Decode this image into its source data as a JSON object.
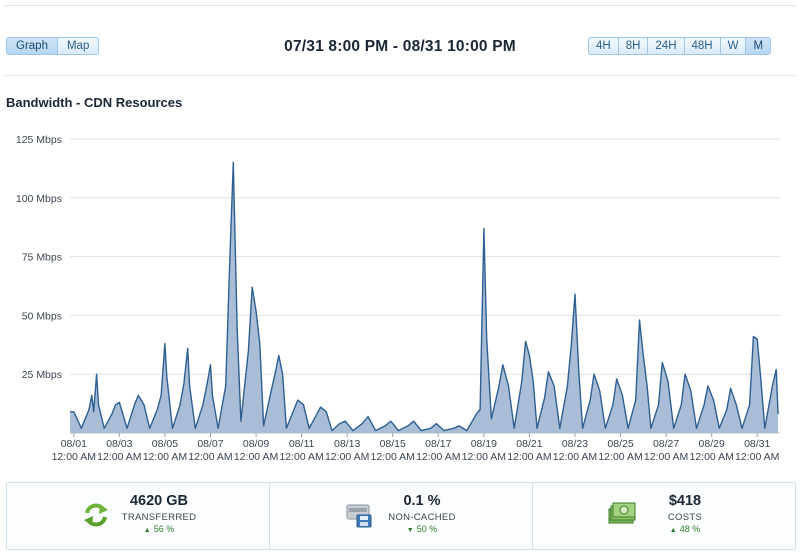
{
  "toolbar": {
    "view_buttons": [
      "Graph",
      "Map"
    ],
    "active_view": "Graph",
    "date_range": "07/31 8:00 PM - 08/31 10:00 PM",
    "range_buttons": [
      "4H",
      "8H",
      "24H",
      "48H",
      "W",
      "M"
    ],
    "active_range": "M"
  },
  "chart_title": "Bandwidth - CDN Resources",
  "chart_data": {
    "type": "area",
    "title": "Bandwidth - CDN Resources",
    "xlabel": "",
    "ylabel": "",
    "ylim": [
      0,
      125
    ],
    "yticks": [
      25,
      50,
      75,
      100,
      125
    ],
    "ytick_labels": [
      "25 Mbps",
      "50 Mbps",
      "75 Mbps",
      "100 Mbps",
      "125 Mbps"
    ],
    "xlim": [
      "2024-08-01",
      "2024-09-01"
    ],
    "xtick_labels": [
      {
        "date": "2024-08-01",
        "line1": "08/01",
        "line2": "12:00 AM"
      },
      {
        "date": "2024-08-03",
        "line1": "08/03",
        "line2": "12:00 AM"
      },
      {
        "date": "2024-08-05",
        "line1": "08/05",
        "line2": "12:00 AM"
      },
      {
        "date": "2024-08-07",
        "line1": "08/07",
        "line2": "12:00 AM"
      },
      {
        "date": "2024-08-09",
        "line1": "08/09",
        "line2": "12:00 AM"
      },
      {
        "date": "2024-08-11",
        "line1": "08/11",
        "line2": "12:00 AM"
      },
      {
        "date": "2024-08-13",
        "line1": "08/13",
        "line2": "12:00 AM"
      },
      {
        "date": "2024-08-15",
        "line1": "08/15",
        "line2": "12:00 AM"
      },
      {
        "date": "2024-08-17",
        "line1": "08/17",
        "line2": "12:00 AM"
      },
      {
        "date": "2024-08-19",
        "line1": "08/19",
        "line2": "12:00 AM"
      },
      {
        "date": "2024-08-21",
        "line1": "08/21",
        "line2": "12:00 AM"
      },
      {
        "date": "2024-08-23",
        "line1": "08/23",
        "line2": "12:00 AM"
      },
      {
        "date": "2024-08-25",
        "line1": "08/25",
        "line2": "12:00 AM"
      },
      {
        "date": "2024-08-27",
        "line1": "08/27",
        "line2": "12:00 AM"
      },
      {
        "date": "2024-08-29",
        "line1": "08/29",
        "line2": "12:00 AM"
      },
      {
        "date": "2024-08-31",
        "line1": "08/31",
        "line2": "12:00 AM"
      }
    ],
    "grid": true,
    "series": [
      {
        "color": "#2e5f91",
        "fill": "#a9bdd6",
        "points": [
          [
            "2024-07-31 20:00",
            9
          ],
          [
            "2024-08-01 00:00",
            9
          ],
          [
            "2024-08-01 08:00",
            2
          ],
          [
            "2024-08-01 16:00",
            10
          ],
          [
            "2024-08-01 19:00",
            16
          ],
          [
            "2024-08-01 21:00",
            9
          ],
          [
            "2024-08-02 00:00",
            25
          ],
          [
            "2024-08-02 02:00",
            12
          ],
          [
            "2024-08-02 08:00",
            2
          ],
          [
            "2024-08-02 16:00",
            8
          ],
          [
            "2024-08-02 20:00",
            12
          ],
          [
            "2024-08-03 00:00",
            13
          ],
          [
            "2024-08-03 08:00",
            2
          ],
          [
            "2024-08-03 16:00",
            12
          ],
          [
            "2024-08-03 20:00",
            16
          ],
          [
            "2024-08-04 02:00",
            12
          ],
          [
            "2024-08-04 08:00",
            2
          ],
          [
            "2024-08-04 16:00",
            10
          ],
          [
            "2024-08-04 20:00",
            16
          ],
          [
            "2024-08-05 00:00",
            38
          ],
          [
            "2024-08-05 02:00",
            24
          ],
          [
            "2024-08-05 08:00",
            2
          ],
          [
            "2024-08-05 16:00",
            12
          ],
          [
            "2024-08-05 20:00",
            21
          ],
          [
            "2024-08-06 00:00",
            36
          ],
          [
            "2024-08-06 02:00",
            20
          ],
          [
            "2024-08-06 08:00",
            2
          ],
          [
            "2024-08-06 16:00",
            12
          ],
          [
            "2024-08-06 20:00",
            20
          ],
          [
            "2024-08-07 00:00",
            29
          ],
          [
            "2024-08-07 02:00",
            16
          ],
          [
            "2024-08-07 08:00",
            2
          ],
          [
            "2024-08-07 16:00",
            20
          ],
          [
            "2024-08-07 20:00",
            70
          ],
          [
            "2024-08-08 00:00",
            115
          ],
          [
            "2024-08-08 04:00",
            45
          ],
          [
            "2024-08-08 08:00",
            5
          ],
          [
            "2024-08-08 16:00",
            35
          ],
          [
            "2024-08-08 20:00",
            62
          ],
          [
            "2024-08-09 00:00",
            52
          ],
          [
            "2024-08-09 04:00",
            38
          ],
          [
            "2024-08-09 08:00",
            3
          ],
          [
            "2024-08-09 16:00",
            18
          ],
          [
            "2024-08-09 20:00",
            25
          ],
          [
            "2024-08-10 00:00",
            33
          ],
          [
            "2024-08-10 04:00",
            25
          ],
          [
            "2024-08-10 08:00",
            2
          ],
          [
            "2024-08-10 16:00",
            10
          ],
          [
            "2024-08-10 20:00",
            14
          ],
          [
            "2024-08-11 02:00",
            12
          ],
          [
            "2024-08-11 08:00",
            2
          ],
          [
            "2024-08-11 16:00",
            8
          ],
          [
            "2024-08-11 20:00",
            11
          ],
          [
            "2024-08-12 02:00",
            9
          ],
          [
            "2024-08-12 08:00",
            1
          ],
          [
            "2024-08-12 16:00",
            4
          ],
          [
            "2024-08-12 22:00",
            5
          ],
          [
            "2024-08-13 06:00",
            1
          ],
          [
            "2024-08-13 16:00",
            4
          ],
          [
            "2024-08-13 22:00",
            7
          ],
          [
            "2024-08-14 06:00",
            1
          ],
          [
            "2024-08-14 16:00",
            3
          ],
          [
            "2024-08-14 22:00",
            5
          ],
          [
            "2024-08-15 06:00",
            1
          ],
          [
            "2024-08-15 16:00",
            3
          ],
          [
            "2024-08-15 22:00",
            5
          ],
          [
            "2024-08-16 06:00",
            1
          ],
          [
            "2024-08-16 16:00",
            2
          ],
          [
            "2024-08-16 22:00",
            4
          ],
          [
            "2024-08-17 06:00",
            1
          ],
          [
            "2024-08-17 16:00",
            2
          ],
          [
            "2024-08-17 22:00",
            3
          ],
          [
            "2024-08-18 06:00",
            1
          ],
          [
            "2024-08-18 16:00",
            8
          ],
          [
            "2024-08-18 20:00",
            10
          ],
          [
            "2024-08-19 00:00",
            87
          ],
          [
            "2024-08-19 03:00",
            40
          ],
          [
            "2024-08-19 08:00",
            6
          ],
          [
            "2024-08-19 16:00",
            20
          ],
          [
            "2024-08-19 20:00",
            29
          ],
          [
            "2024-08-20 02:00",
            20
          ],
          [
            "2024-08-20 08:00",
            2
          ],
          [
            "2024-08-20 16:00",
            22
          ],
          [
            "2024-08-20 20:00",
            39
          ],
          [
            "2024-08-21 00:00",
            33
          ],
          [
            "2024-08-21 04:00",
            22
          ],
          [
            "2024-08-21 08:00",
            2
          ],
          [
            "2024-08-21 16:00",
            15
          ],
          [
            "2024-08-21 20:00",
            26
          ],
          [
            "2024-08-22 02:00",
            20
          ],
          [
            "2024-08-22 08:00",
            2
          ],
          [
            "2024-08-22 16:00",
            20
          ],
          [
            "2024-08-22 20:00",
            37
          ],
          [
            "2024-08-23 00:00",
            59
          ],
          [
            "2024-08-23 04:00",
            26
          ],
          [
            "2024-08-23 08:00",
            2
          ],
          [
            "2024-08-23 16:00",
            14
          ],
          [
            "2024-08-23 20:00",
            25
          ],
          [
            "2024-08-24 02:00",
            18
          ],
          [
            "2024-08-24 08:00",
            2
          ],
          [
            "2024-08-24 16:00",
            12
          ],
          [
            "2024-08-24 20:00",
            23
          ],
          [
            "2024-08-25 02:00",
            16
          ],
          [
            "2024-08-25 08:00",
            2
          ],
          [
            "2024-08-25 16:00",
            14
          ],
          [
            "2024-08-25 20:00",
            48
          ],
          [
            "2024-08-26 00:00",
            33
          ],
          [
            "2024-08-26 04:00",
            20
          ],
          [
            "2024-08-26 08:00",
            2
          ],
          [
            "2024-08-26 16:00",
            12
          ],
          [
            "2024-08-26 20:00",
            30
          ],
          [
            "2024-08-27 02:00",
            22
          ],
          [
            "2024-08-27 08:00",
            2
          ],
          [
            "2024-08-27 16:00",
            12
          ],
          [
            "2024-08-27 20:00",
            25
          ],
          [
            "2024-08-28 02:00",
            18
          ],
          [
            "2024-08-28 08:00",
            2
          ],
          [
            "2024-08-28 16:00",
            12
          ],
          [
            "2024-08-28 20:00",
            20
          ],
          [
            "2024-08-29 02:00",
            14
          ],
          [
            "2024-08-29 08:00",
            2
          ],
          [
            "2024-08-29 16:00",
            10
          ],
          [
            "2024-08-29 20:00",
            19
          ],
          [
            "2024-08-30 02:00",
            12
          ],
          [
            "2024-08-30 08:00",
            2
          ],
          [
            "2024-08-30 16:00",
            12
          ],
          [
            "2024-08-30 20:00",
            41
          ],
          [
            "2024-08-31 00:00",
            40
          ],
          [
            "2024-08-31 04:00",
            22
          ],
          [
            "2024-08-31 08:00",
            2
          ],
          [
            "2024-08-31 16:00",
            20
          ],
          [
            "2024-08-31 20:00",
            27
          ],
          [
            "2024-08-31 22:00",
            8
          ]
        ]
      }
    ]
  },
  "stats": [
    {
      "icon": "transfer-arrows-icon",
      "value": "4620 GB",
      "label": "TRANSFERRED",
      "change": "56 %",
      "change_direction": "up"
    },
    {
      "icon": "disk-drive-icon",
      "value": "0.1 %",
      "label": "NON-CACHED",
      "change": "50 %",
      "change_direction": "down"
    },
    {
      "icon": "money-stack-icon",
      "value": "$418",
      "label": "COSTS",
      "change": "48 %",
      "change_direction": "up"
    }
  ],
  "colors": {
    "accent": "#2e5f91",
    "fill": "#a9bdd6",
    "positive": "#2f7d2b"
  }
}
